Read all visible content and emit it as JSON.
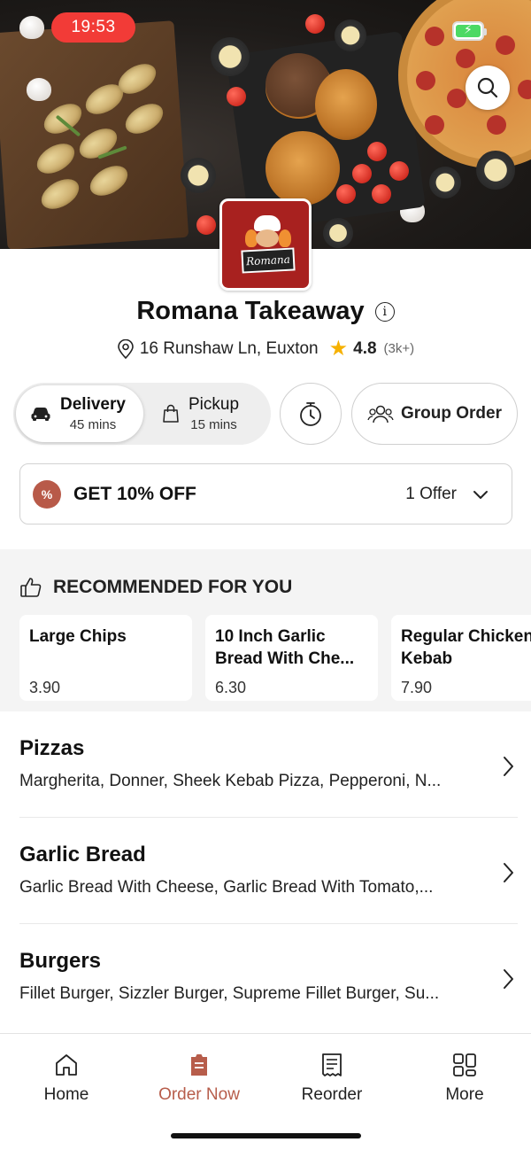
{
  "status_bar": {
    "time": "19:53"
  },
  "restaurant": {
    "name": "Romana Takeaway",
    "logo_text": "Romana",
    "address": "16 Runshaw Ln, Euxton",
    "rating": "4.8",
    "rating_count": "(3k+)"
  },
  "modes": {
    "delivery": {
      "label": "Delivery",
      "time": "45 mins"
    },
    "pickup": {
      "label": "Pickup",
      "time": "15 mins"
    }
  },
  "group_order_label": "Group Order",
  "offer": {
    "title": "GET 10% OFF",
    "count": "1 Offer"
  },
  "recommended": {
    "heading": "RECOMMENDED FOR YOU",
    "items": [
      {
        "name": "Large Chips",
        "price": "3.90"
      },
      {
        "name": "10 Inch Garlic Bread With Che...",
        "price": "6.30"
      },
      {
        "name": "Regular Chicken Kebab",
        "price": "7.90"
      }
    ]
  },
  "categories": [
    {
      "title": "Pizzas",
      "desc": "Margherita, Donner, Sheek Kebab Pizza, Pepperoni, N..."
    },
    {
      "title": "Garlic Bread",
      "desc": "Garlic Bread With Cheese, Garlic Bread With Tomato,..."
    },
    {
      "title": "Burgers",
      "desc": "Fillet Burger, Sizzler Burger, Supreme Fillet Burger, Su..."
    }
  ],
  "nav": [
    {
      "label": "Home",
      "icon": "home-icon"
    },
    {
      "label": "Order Now",
      "icon": "order-bag-icon",
      "active": true
    },
    {
      "label": "Reorder",
      "icon": "receipt-icon"
    },
    {
      "label": "More",
      "icon": "grid-icon"
    }
  ],
  "colors": {
    "accent": "#b75d4b",
    "logo_bg": "#a8211f",
    "status_time_bg": "#f23b37",
    "battery": "#4cd964",
    "star": "#f6b100"
  }
}
